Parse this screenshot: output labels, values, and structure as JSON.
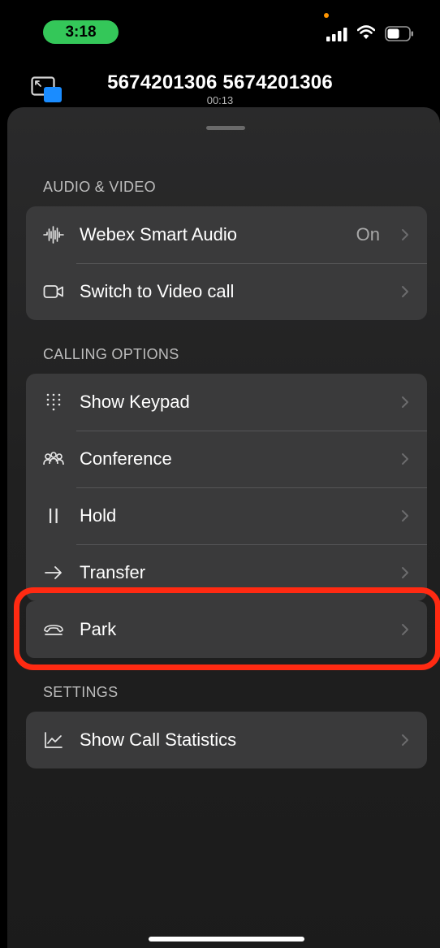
{
  "status_bar": {
    "time": "3:18"
  },
  "call": {
    "caller": "5674201306 5674201306",
    "duration": "00:13"
  },
  "sections": {
    "audio_video": "AUDIO & VIDEO",
    "calling_options": "CALLING OPTIONS",
    "settings": "SETTINGS"
  },
  "audio_video_items": [
    {
      "label": "Webex Smart Audio",
      "value": "On",
      "icon": "waveform-icon"
    },
    {
      "label": "Switch to Video call",
      "icon": "video-camera-icon"
    }
  ],
  "calling_options_items": [
    {
      "label": "Show Keypad",
      "icon": "keypad-icon"
    },
    {
      "label": "Conference",
      "icon": "people-icon"
    },
    {
      "label": "Hold",
      "icon": "pause-icon"
    },
    {
      "label": "Transfer",
      "icon": "arrow-right-icon"
    },
    {
      "label": "Park",
      "icon": "phone-park-icon"
    }
  ],
  "settings_items": [
    {
      "label": "Show Call Statistics",
      "icon": "line-chart-icon"
    }
  ],
  "colors": {
    "time_pill": "#34c759",
    "highlight": "#ff2a12",
    "pip_accent": "#1a8cff"
  }
}
